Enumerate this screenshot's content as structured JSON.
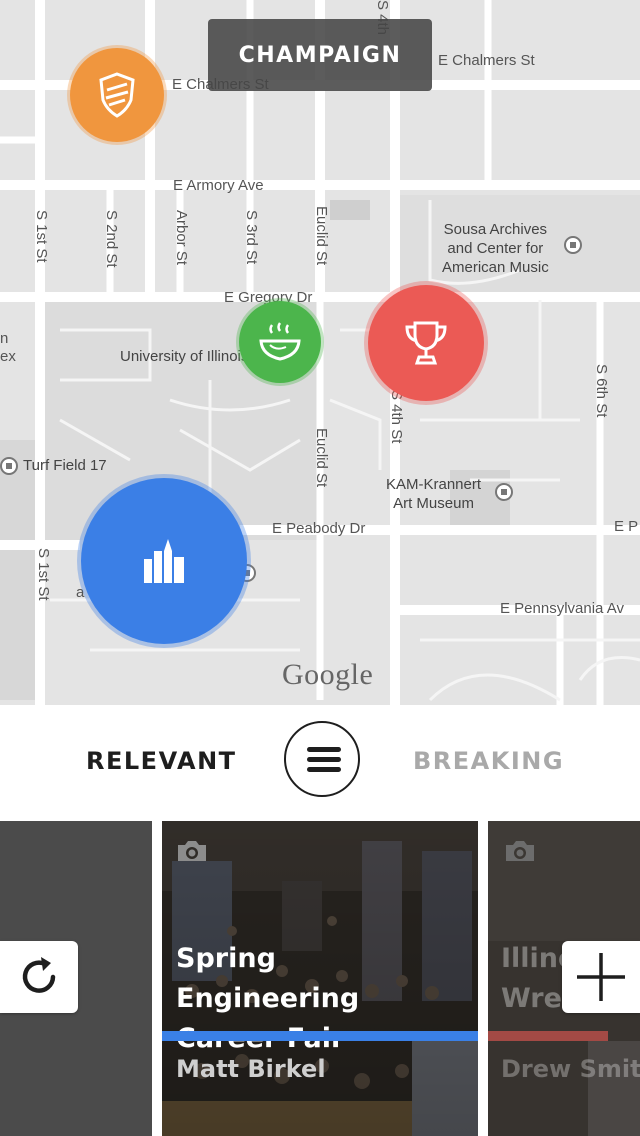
{
  "map": {
    "city": "CHAMPAIGN",
    "attribution": "Google",
    "labels": {
      "chalmers_left": "E Chalmers St",
      "chalmers_right": "E Chalmers St",
      "armory": "E Armory Ave",
      "gregory": "E Gregory Dr",
      "peabody": "E Peabody Dr",
      "peabody_right": "E P",
      "pennsylvania": "E Pennsylvania Av",
      "first_st": "S 1st St",
      "first_st_lower": "S 1st St",
      "second_st": "S 2nd St",
      "arbor_st": "Arbor St",
      "third_st": "S 3rd St",
      "euclid_st": "Euclid St",
      "euclid_st_lower": "Euclid St",
      "fourth_st": "S 4th St",
      "fourth_st_top": "S 4th",
      "sixth_st": "S 6th St",
      "uiuc": "University of Illinois",
      "turf_field": "Turf Field 17",
      "sousa": "Sousa Archives\nand Center for\nAmerican Music",
      "kam": "KAM-Krannert\nArt Museum",
      "edge_n": "n",
      "edge_ex": "ex",
      "edge_a": "a"
    },
    "markers": [
      {
        "name": "shield-marker",
        "color": "#f0963e"
      },
      {
        "name": "food-marker",
        "color": "#4cb54c"
      },
      {
        "name": "trophy-marker",
        "color": "#eb5a55"
      },
      {
        "name": "campus-marker",
        "color": "#3b7fe6"
      }
    ]
  },
  "tabs": {
    "relevant": "RELEVANT",
    "breaking": "BREAKING",
    "menu_icon": "hamburger-icon"
  },
  "cards": {
    "main": {
      "title": "Spring Engineering Career Fair",
      "author": "Matt Birkel",
      "bar_color": "#3a80e6"
    },
    "right": {
      "title": "Illinois Wrestling",
      "title_line1": "Illino",
      "title_line2": "Wres",
      "author": "Drew Smith"
    }
  },
  "buttons": {
    "refresh_icon": "refresh-icon",
    "add_icon": "plus-icon"
  }
}
